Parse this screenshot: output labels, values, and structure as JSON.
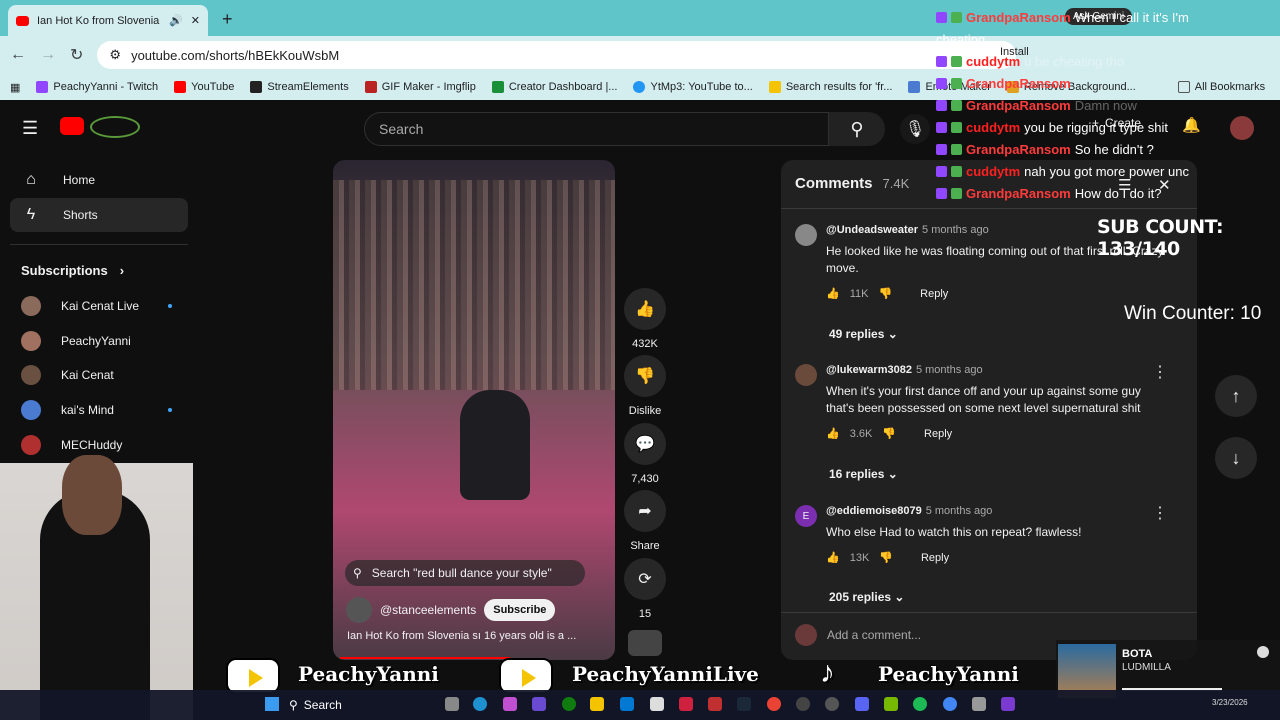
{
  "browser": {
    "tab_title": "Ian Hot Ko from Slovenia s",
    "url": "youtube.com/shorts/hBEkKouWsbM",
    "bookmarks": [
      "PeachyYanni - Twitch",
      "YouTube",
      "StreamElements",
      "GIF Maker - Imgflip",
      "Creator Dashboard |...",
      "YtMp3: YouTube to...",
      "Search results for 'fr...",
      "Emote Maker",
      "Remove Background...",
      "All Bookmarks"
    ],
    "install_label": "Install",
    "ask_label": "Ask Gemini"
  },
  "header": {
    "search_placeholder": "Search",
    "create_label": "Create"
  },
  "sidebar": {
    "home": "Home",
    "shorts": "Shorts",
    "subscriptions_title": "Subscriptions",
    "subs": [
      "Kai Cenat Live",
      "PeachyYanni",
      "Kai Cenat",
      "kai's Mind",
      "MECHuddy"
    ]
  },
  "video": {
    "search_pill": "Search \"red bull dance your style\"",
    "channel": "@stanceelements",
    "subscribe": "Subscribe",
    "description": "Ian Hot Ko from Slovenia ѕı 16 years old is a ..."
  },
  "actions": {
    "likes": "432K",
    "dislike": "Dislike",
    "comments": "7,430",
    "share": "Share",
    "remix": "15"
  },
  "comments": {
    "title": "Comments",
    "count": "7.4K",
    "reply_label": "Reply",
    "add_placeholder": "Add a comment...",
    "items": [
      {
        "user": "@Undeadsweater",
        "time": "5 months ago",
        "text": "He looked like he was floating coming out of that first roll. Crazy move.",
        "likes": "11K",
        "replies": "49 replies"
      },
      {
        "user": "@lukewarm3082",
        "time": "5 months ago",
        "text": "When it's your first dance off and your up against some guy that's been possessed on some next level supernatural shit",
        "likes": "3.6K",
        "replies": "16 replies"
      },
      {
        "user": "@eddiemoise8079",
        "time": "5 months ago",
        "text": "Who else Had to watch this on repeat? flawless!",
        "likes": "13K",
        "replies": "205 replies",
        "initial": "E"
      }
    ]
  },
  "overlay": {
    "chat": [
      {
        "user": "GrandpaRansom",
        "msg": "When I call it it's I'm"
      },
      {
        "user": "",
        "msg": "cheating"
      },
      {
        "user": "cuddytm",
        "msg": "u be cheating tho"
      },
      {
        "user": "GrandpaRansom",
        "msg": ""
      },
      {
        "user": "GrandpaRansom",
        "msg": "Damn now"
      },
      {
        "user": "cuddytm",
        "msg": "you be rigging it type shit"
      },
      {
        "user": "GrandpaRansom",
        "msg": "So he didn't ?"
      },
      {
        "user": "cuddytm",
        "msg": "nah you got more power unc"
      },
      {
        "user": "GrandpaRansom",
        "msg": "How do I do it?"
      }
    ],
    "sub_count": "SUB COUNT: 133/140",
    "win_counter": "Win Counter: 10",
    "banner": [
      "PeachyYanni",
      "PeachyYanniLive",
      "PeachyYanni"
    ],
    "music_title": "BOTA",
    "music_artist": "LUDMILLA"
  },
  "taskbar": {
    "search": "Search",
    "date": "3/23/2026"
  }
}
